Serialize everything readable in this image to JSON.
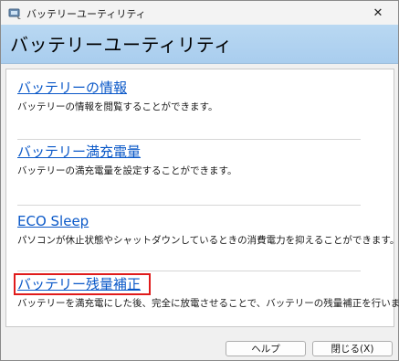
{
  "window": {
    "title": "バッテリーユーティリティ",
    "close_glyph": "✕"
  },
  "header": {
    "title": "バッテリーユーティリティ"
  },
  "items": [
    {
      "link": "バッテリーの情報",
      "description": "バッテリーの情報を閲覧することができます。"
    },
    {
      "link": "バッテリー満充電量",
      "description": "バッテリーの満充電量を設定することができます。"
    },
    {
      "link": "ECO Sleep",
      "description": "パソコンが休止状態やシャットダウンしているときの消費電力を抑えることができます。"
    },
    {
      "link": "バッテリー残量補正",
      "description": "バッテリーを満充電にした後、完全に放電させることで、バッテリーの残量補正を行います。"
    }
  ],
  "highlighted_item_index": 3,
  "buttons": {
    "help": "ヘルプ",
    "close": "閉じる(X)"
  },
  "colors": {
    "header_bg": "#b9d8f2",
    "link": "#0a58c8",
    "highlight_border": "#e01b1b"
  }
}
